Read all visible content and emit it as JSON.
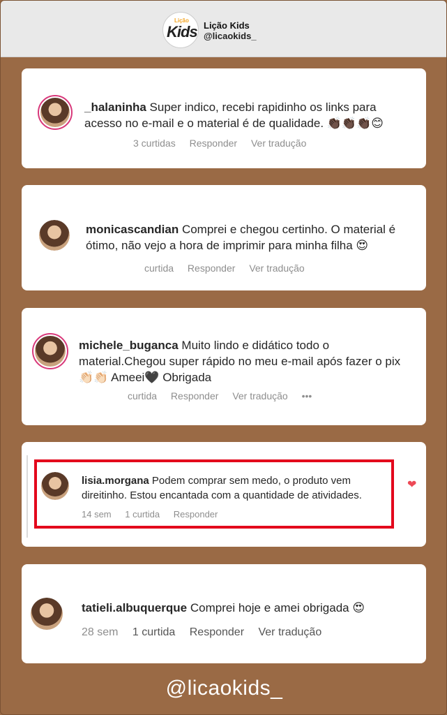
{
  "header": {
    "logo_small": "Lição",
    "logo_big": "Kids",
    "name": "Lição Kids",
    "handle": "@licaokids_"
  },
  "comments": [
    {
      "username": "_halaninha",
      "text": "Super indico, recebi rapidinho os links para acesso no e-mail e o material é de qualidade. 👏🏿👏🏿👏🏿😊",
      "likes": "3 curtidas",
      "reply": "Responder",
      "translate": "Ver tradução"
    },
    {
      "username": "monicascandian",
      "text": "Comprei e chegou certinho. O material é ótimo, não vejo a hora de imprimir para minha filha 😍",
      "likes": "curtida",
      "reply": "Responder",
      "translate": "Ver tradução"
    },
    {
      "username": "michele_buganca",
      "text": "Muito lindo e didático todo o material.Chegou super rápido no meu e-mail após fazer o pix 👏🏻👏🏻 Ameei🖤 Obrigada",
      "likes": "curtida",
      "reply": "Responder",
      "translate": "Ver tradução",
      "more": "•••"
    },
    {
      "username": "lisia.morgana",
      "text": "Podem comprar sem medo, o produto vem direitinho. Estou encantada com a quantidade de atividades.",
      "time": "14 sem",
      "likes": "1 curtida",
      "reply": "Responder"
    },
    {
      "username": "tatieli.albuquerque",
      "text": "Comprei hoje e amei obrigada 😍",
      "time": "28 sem",
      "likes": "1 curtida",
      "reply": "Responder",
      "translate": "Ver tradução"
    }
  ],
  "footer": {
    "handle": "@licaokids_"
  },
  "colors": {
    "background": "#9a6a45",
    "highlight": "#e3071c",
    "heart": "#ed4956"
  }
}
